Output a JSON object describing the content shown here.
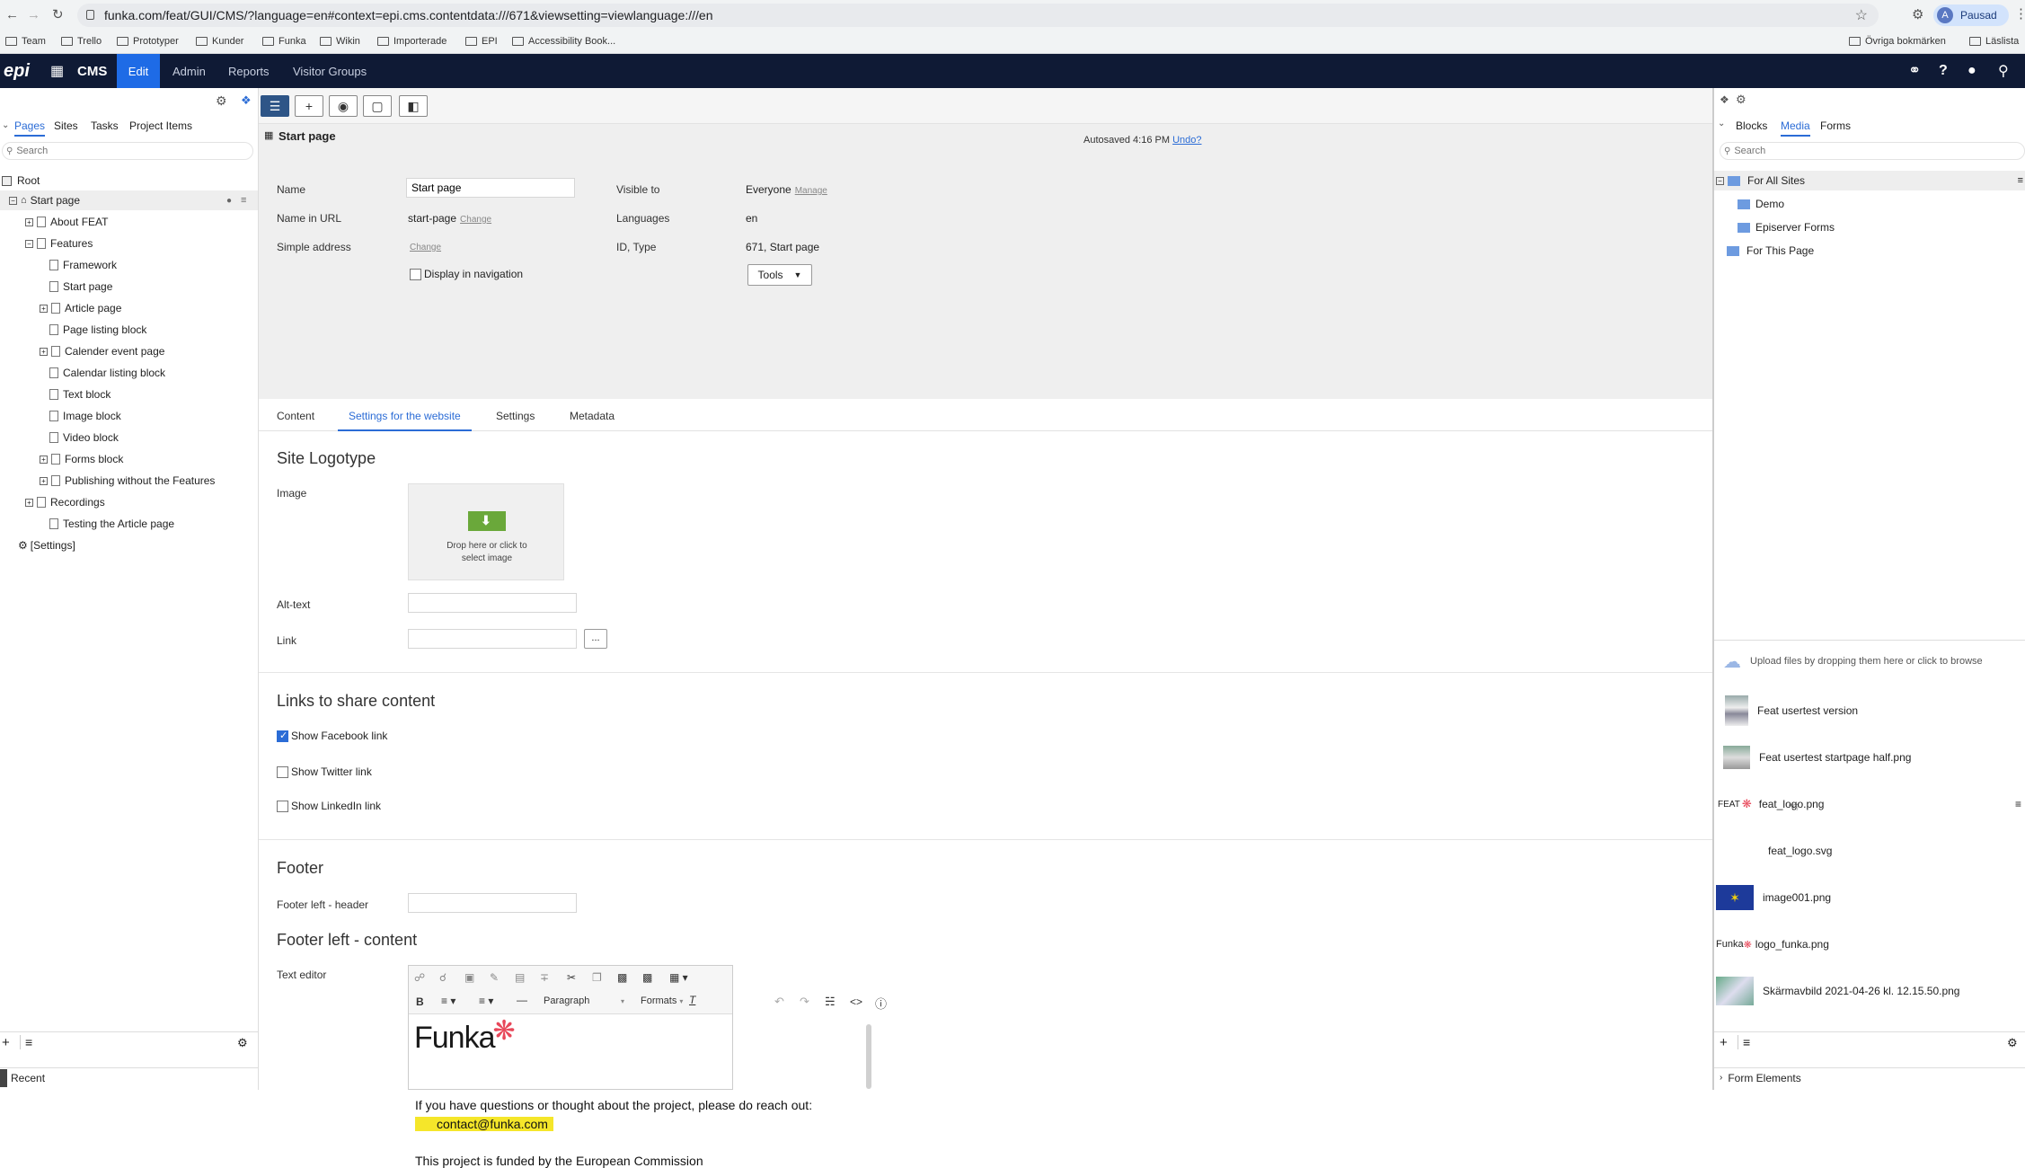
{
  "browser": {
    "url": "funka.com/feat/GUI/CMS/?language=en#context=epi.cms.contentdata:///671&viewsetting=viewlanguage:///en",
    "profile_initial": "A",
    "profile_label": "Pausad",
    "bookmarks": [
      "Team",
      "Trello",
      "Prototyper",
      "Kunder",
      "Funka",
      "Wikin",
      "Importerade",
      "EPI",
      "Accessibility Book..."
    ],
    "bookmarks_right": [
      "Övriga bokmärken",
      "Läslista"
    ]
  },
  "epi_nav": {
    "logo": "epi",
    "app": "CMS",
    "items": [
      "Edit",
      "Admin",
      "Reports",
      "Visitor Groups"
    ]
  },
  "left": {
    "tabs": [
      "Pages",
      "Sites",
      "Tasks",
      "Project Items"
    ],
    "search_placeholder": "Search",
    "tree": [
      "Root",
      "Start page",
      "About FEAT",
      "Features",
      "Framework",
      "Start page",
      "Article page",
      "Page listing block",
      "Calender event page",
      "Calendar listing block",
      "Text block",
      "Image block",
      "Video block",
      "Forms block",
      "Publishing without the Features",
      "Recordings",
      "Testing the Article page",
      "[Settings]"
    ],
    "recent": "Recent"
  },
  "main": {
    "page_title": "Start page",
    "autosaved": "Autosaved 4:16 PM",
    "undo": "Undo?",
    "name_label": "Name",
    "name_value": "Start page",
    "url_label": "Name in URL",
    "url_value": "start-page",
    "change": "Change",
    "simple_label": "Simple address",
    "display_nav": "Display in navigation",
    "visible_label": "Visible to",
    "visible_value": "Everyone",
    "manage": "Manage",
    "lang_label": "Languages",
    "lang_value": "en",
    "id_label": "ID, Type",
    "id_value": "671, Start page",
    "tools": "Tools",
    "tabs": [
      "Content",
      "Settings for the website",
      "Settings",
      "Metadata"
    ],
    "site_logotype": "Site Logotype",
    "image_label": "Image",
    "drop_text": "Drop here or click to select image",
    "alt_label": "Alt-text",
    "link_label": "Link",
    "link_btn": "...",
    "links_share": "Links to share content",
    "fb": "Show Facebook link",
    "tw": "Show Twitter link",
    "li": "Show LinkedIn link",
    "footer": "Footer",
    "footer_left_header": "Footer left - header",
    "footer_left_content": "Footer left - content",
    "text_editor": "Text editor",
    "paragraph": "Paragraph",
    "formats": "Formats",
    "funka_logo": "Funka",
    "editor_text": "If you have questions or thought about the project, please do reach out:",
    "email": "contact@funka.com",
    "funded": "This project is funded by the European Commission"
  },
  "right": {
    "tabs": [
      "Blocks",
      "Media",
      "Forms"
    ],
    "search_placeholder": "Search",
    "folders": [
      "For All Sites",
      "Demo",
      "Episerver Forms",
      "For This Page"
    ],
    "upload": "Upload files by dropping them here or click to browse",
    "media": [
      "Feat usertest version",
      "Feat usertest startpage half.png",
      "feat_logo.png",
      "feat_logo.svg",
      "image001.png",
      "logo_funka.png",
      "Skärmavbild 2021-04-26 kl. 12.15.50.png"
    ],
    "feat_label": "FEAT",
    "funka_label": "Funka",
    "form_elements": "Form Elements"
  },
  "colors": {
    "nav_bg": "#0f1a35",
    "accent": "#2b6cd6",
    "edit_active": "#1e6be6",
    "green": "#6aa83a",
    "highlight": "#f5e62a"
  }
}
